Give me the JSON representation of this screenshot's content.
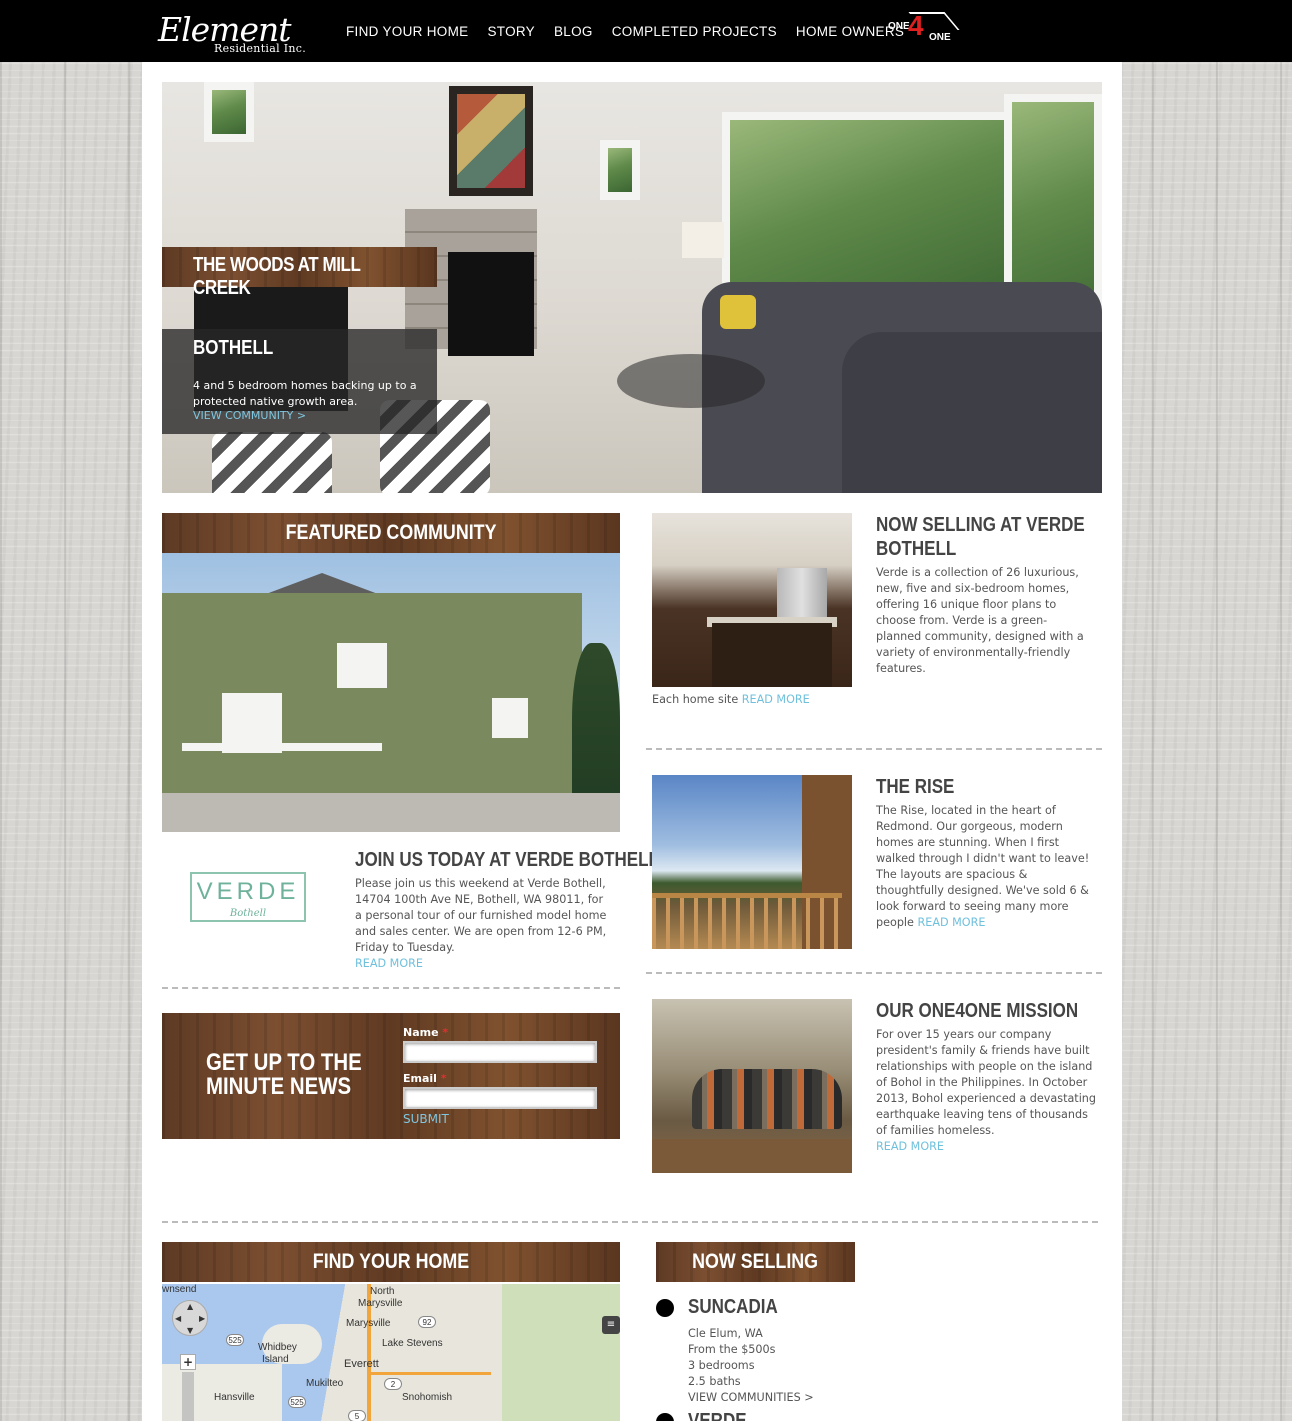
{
  "header": {
    "logo_main": "Element",
    "logo_sub": "Residential Inc.",
    "nav": [
      "FIND YOUR HOME",
      "STORY",
      "BLOG",
      "COMPLETED PROJECTS",
      "HOME OWNERS"
    ],
    "one4one": {
      "one_a": "ONE",
      "four": "4",
      "one_b": "ONE"
    }
  },
  "hero": {
    "title": "THE WOODS AT MILL CREEK",
    "city": "BOTHELL",
    "description": "4 and 5 bedroom homes backing up to a protected native growth area.",
    "link": "VIEW COMMUNITY >"
  },
  "featured": {
    "heading": "FEATURED COMMUNITY",
    "logo_word": "VERDE",
    "logo_sub": "Bothell",
    "title": "JOIN US TODAY AT VERDE BOTHELL",
    "text": "Please join us this weekend at Verde Bothell, 14704 100th Ave NE, Bothell, WA 98011, for a personal tour of our furnished model home and sales center.  We are open from 12-6 PM, Friday to Tuesday.",
    "read_more": "READ MORE"
  },
  "newsletter": {
    "title_line1": "GET UP TO THE",
    "title_line2": "MINUTE NEWS",
    "name_label": "Name",
    "email_label": "Email",
    "required_mark": "*",
    "submit": "SUBMIT"
  },
  "posts": [
    {
      "title_line1": "NOW SELLING AT VERDE",
      "title_line2": "BOTHELL",
      "text": "Verde is a collection of 26 luxurious, new, five and six-bedroom homes, offering 16 unique floor plans to choose from. Verde is a green-planned community, designed with a variety of environmentally-friendly features.",
      "caption": "Each home site",
      "read_more": "READ MORE"
    },
    {
      "title_line1": "THE RISE",
      "text": "The Rise, located in the heart of Redmond.  Our gorgeous, modern homes are stunning.  When I first walked through I didn't want to leave!  The layouts are spacious & thoughtfully designed.  We've sold 6 & look forward to seeing many more people",
      "read_more": "READ MORE"
    },
    {
      "title_line1": "OUR ONE4ONE MISSION",
      "text": "For over 15 years our company president's family & friends have built relationships with people on the island of Bohol in the Philippines. In October 2013, Bohol experienced a devastating earthquake leaving tens of thousands of families homeless.",
      "read_more": "READ MORE"
    }
  ],
  "find_home": {
    "heading": "FIND YOUR HOME",
    "map_labels": {
      "wnsend": "wnsend",
      "north": "North",
      "marysville_n": "Marysville",
      "marysville": "Marysville",
      "lake_stevens": "Lake Stevens",
      "whidbey1": "Whidbey",
      "whidbey2": "Island",
      "everett": "Everett",
      "mukilteo": "Mukilteo",
      "snohomish": "Snohomish",
      "hansville": "Hansville"
    },
    "shields": [
      "525",
      "92",
      "525",
      "2",
      "5"
    ],
    "zoom_in": "+",
    "layers_icon": "layers-icon"
  },
  "now_selling": {
    "heading": "NOW SELLING",
    "items": [
      {
        "name": "SUNCADIA",
        "location": "Cle Elum, WA",
        "price": "From the $500s",
        "beds": "3 bedrooms",
        "baths": "2.5 baths",
        "link": "VIEW COMMUNITIES >"
      },
      {
        "name": "VERDE"
      }
    ]
  }
}
